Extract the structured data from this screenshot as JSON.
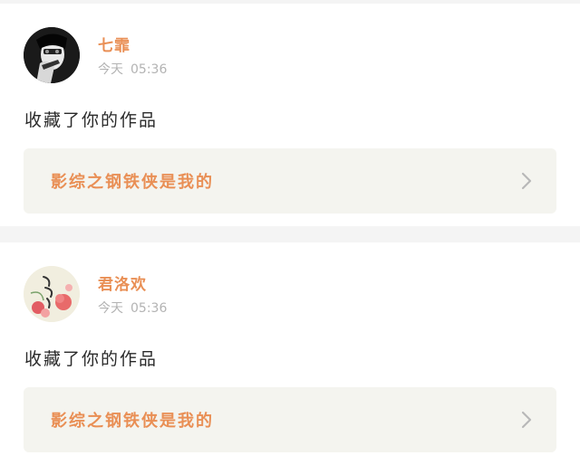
{
  "notifications": [
    {
      "username": "七霏",
      "time_day": "今天",
      "time_clock": "05:36",
      "action": "收藏了你的作品",
      "work_title": "影综之钢铁侠是我的",
      "avatar_icon": "portrait-dark-icon"
    },
    {
      "username": "君洛欢",
      "time_day": "今天",
      "time_clock": "05:36",
      "action": "收藏了你的作品",
      "work_title": "影综之钢铁侠是我的",
      "avatar_icon": "floral-calligraphy-icon"
    }
  ],
  "colors": {
    "accent": "#e98f55",
    "muted": "#b3b3b3",
    "card_bg": "#ffffff",
    "work_bg": "#f4f4ef",
    "page_bg": "#f4f4f4"
  }
}
